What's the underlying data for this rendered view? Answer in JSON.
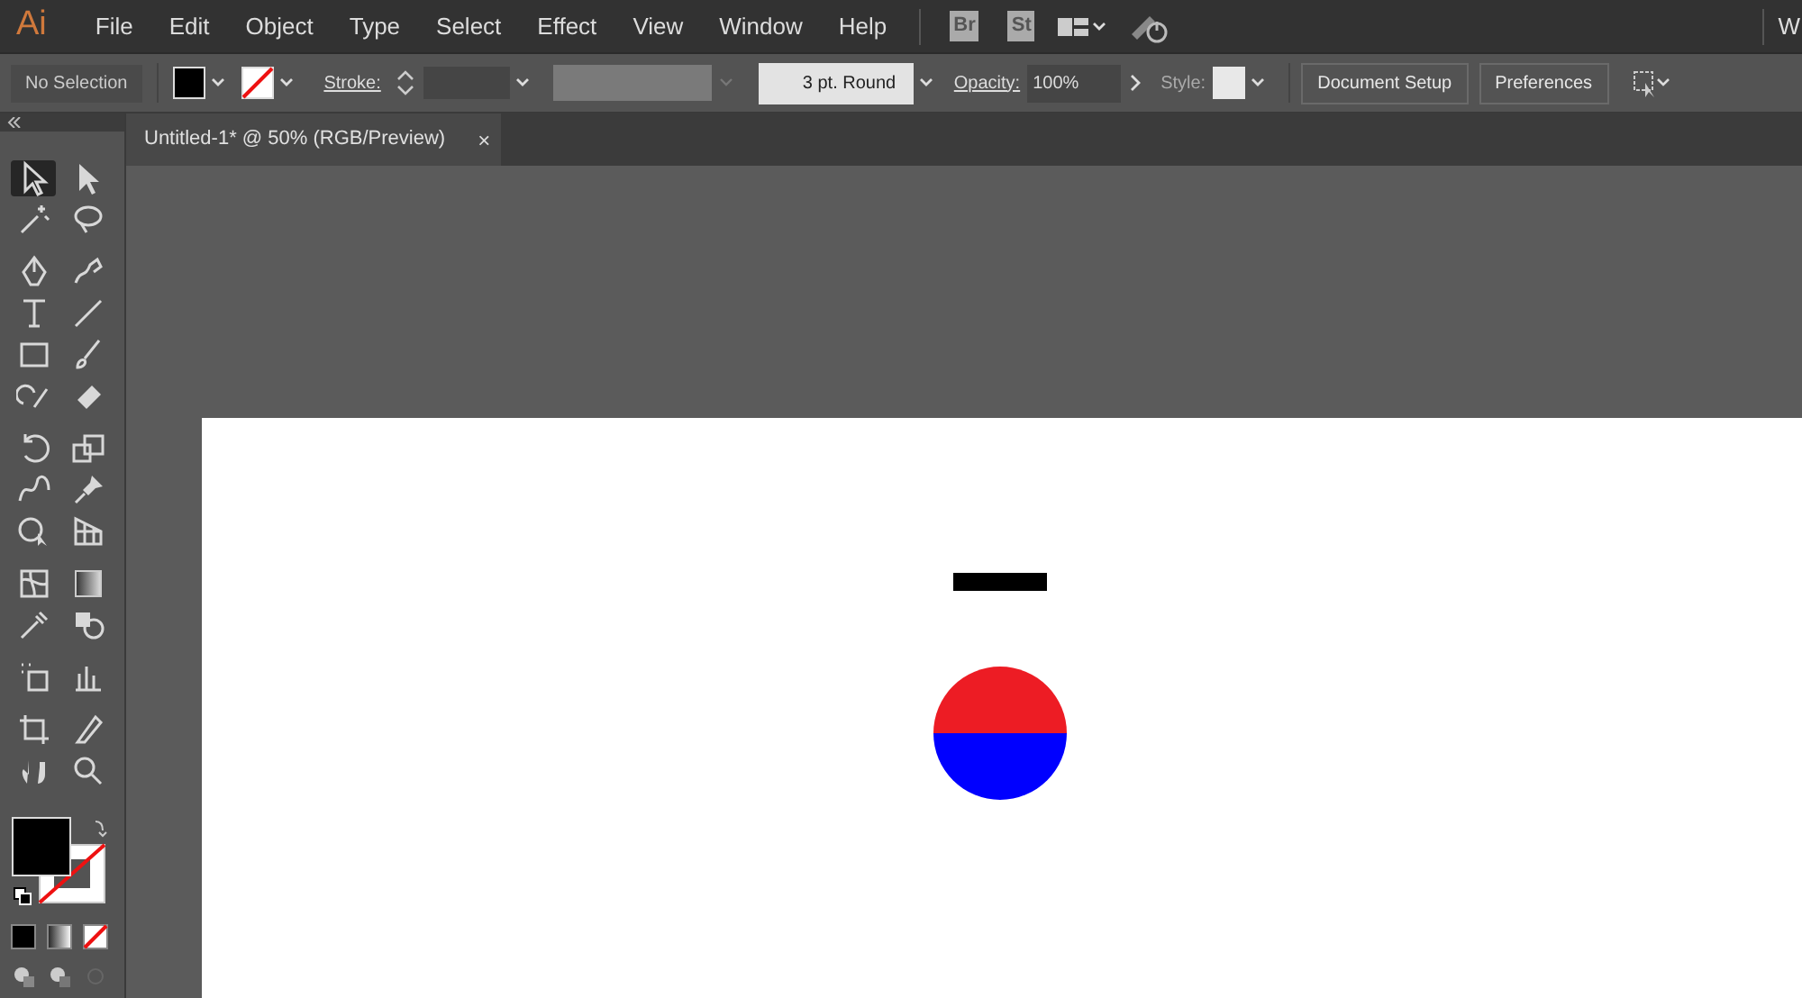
{
  "app": {
    "logo": "Ai",
    "menu": [
      "File",
      "Edit",
      "Object",
      "Type",
      "Select",
      "Effect",
      "View",
      "Window",
      "Help"
    ],
    "bridge": "Br",
    "stock": "St",
    "workspace": "W"
  },
  "control_bar": {
    "selection": "No Selection",
    "stroke_label": "Stroke:",
    "brush": "3 pt. Round",
    "opacity_label": "Opacity:",
    "opacity": "100%",
    "style_label": "Style:",
    "buttons": [
      "Document Setup",
      "Preferences"
    ]
  },
  "document_tab": {
    "title": "Untitled-1* @ 50% (RGB/Preview)",
    "close": "×"
  },
  "tools": [
    [
      {
        "kind": "selection",
        "selected": true
      },
      {
        "kind": "direct",
        "selected": false
      }
    ],
    [
      {
        "kind": "wand",
        "selected": false
      },
      {
        "kind": "lasso",
        "selected": false
      }
    ],
    [
      {
        "kind": "pen",
        "selected": false
      },
      {
        "kind": "curvature",
        "selected": false
      }
    ],
    [
      {
        "kind": "type",
        "selected": false
      },
      {
        "kind": "line",
        "selected": false
      }
    ],
    [
      {
        "kind": "rect",
        "selected": false
      },
      {
        "kind": "brush",
        "selected": false
      }
    ],
    [
      {
        "kind": "shaper",
        "selected": false
      },
      {
        "kind": "eraser",
        "selected": false
      }
    ],
    [
      {
        "kind": "rotate",
        "selected": false
      },
      {
        "kind": "scale",
        "selected": false
      }
    ],
    [
      {
        "kind": "warp",
        "selected": false
      },
      {
        "kind": "pin",
        "selected": false
      }
    ],
    [
      {
        "kind": "shapebuilder",
        "selected": false
      },
      {
        "kind": "perspective",
        "selected": false
      }
    ],
    [
      {
        "kind": "mesh",
        "selected": false
      },
      {
        "kind": "gradient",
        "selected": false
      }
    ],
    [
      {
        "kind": "eyedropper",
        "selected": false
      },
      {
        "kind": "blend",
        "selected": false
      }
    ],
    [
      {
        "kind": "symbol",
        "selected": false
      },
      {
        "kind": "graph",
        "selected": false
      }
    ],
    [
      {
        "kind": "artboard",
        "selected": false
      },
      {
        "kind": "slice",
        "selected": false
      }
    ],
    [
      {
        "kind": "hand",
        "selected": false
      },
      {
        "kind": "zoom",
        "selected": false
      }
    ]
  ],
  "artwork": [
    {
      "kind": "bar"
    },
    {
      "kind": "circle",
      "halves": [
        {
          "color": "#ed1c24"
        },
        {
          "color": "#0000ff"
        }
      ]
    }
  ]
}
